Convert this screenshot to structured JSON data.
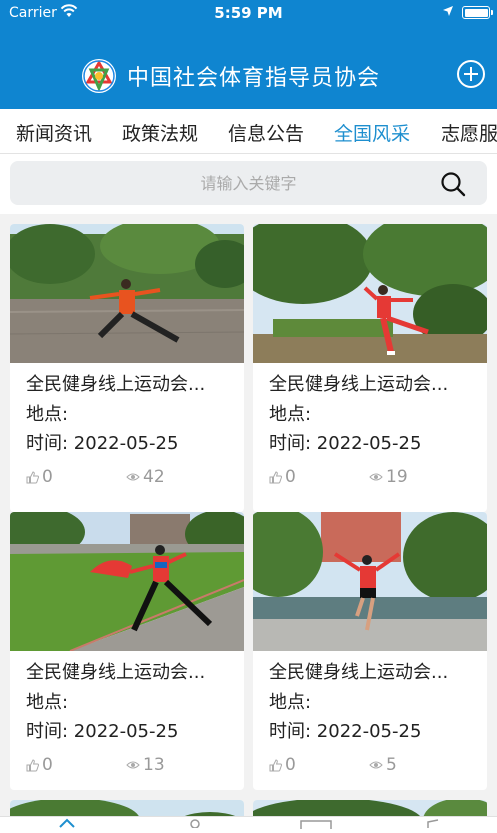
{
  "status": {
    "carrier": "Carrier",
    "time": "5:59 PM"
  },
  "header": {
    "title": "中国社会体育指导员协会"
  },
  "tabs": [
    {
      "label": "新闻资讯",
      "active": false
    },
    {
      "label": "政策法规",
      "active": false
    },
    {
      "label": "信息公告",
      "active": false
    },
    {
      "label": "全国风采",
      "active": true
    },
    {
      "label": "志愿服"
    }
  ],
  "search": {
    "placeholder": "请输入关键字"
  },
  "cards": [
    {
      "title": "全民健身线上运动会...",
      "place": "地点:",
      "time": "时间: 2022-05-25",
      "likes": "0",
      "views": "42"
    },
    {
      "title": "全民健身线上运动会...",
      "place": "地点:",
      "time": "时间: 2022-05-25",
      "likes": "0",
      "views": "19"
    },
    {
      "title": "全民健身线上运动会...",
      "place": "地点:",
      "time": "时间: 2022-05-25",
      "likes": "0",
      "views": "13"
    },
    {
      "title": "全民健身线上运动会...",
      "place": "地点:",
      "time": "时间: 2022-05-25",
      "likes": "0",
      "views": "5"
    }
  ],
  "colors": {
    "brand": "#0f85d0",
    "tab_active": "#1e8fcf",
    "muted": "#999999"
  }
}
